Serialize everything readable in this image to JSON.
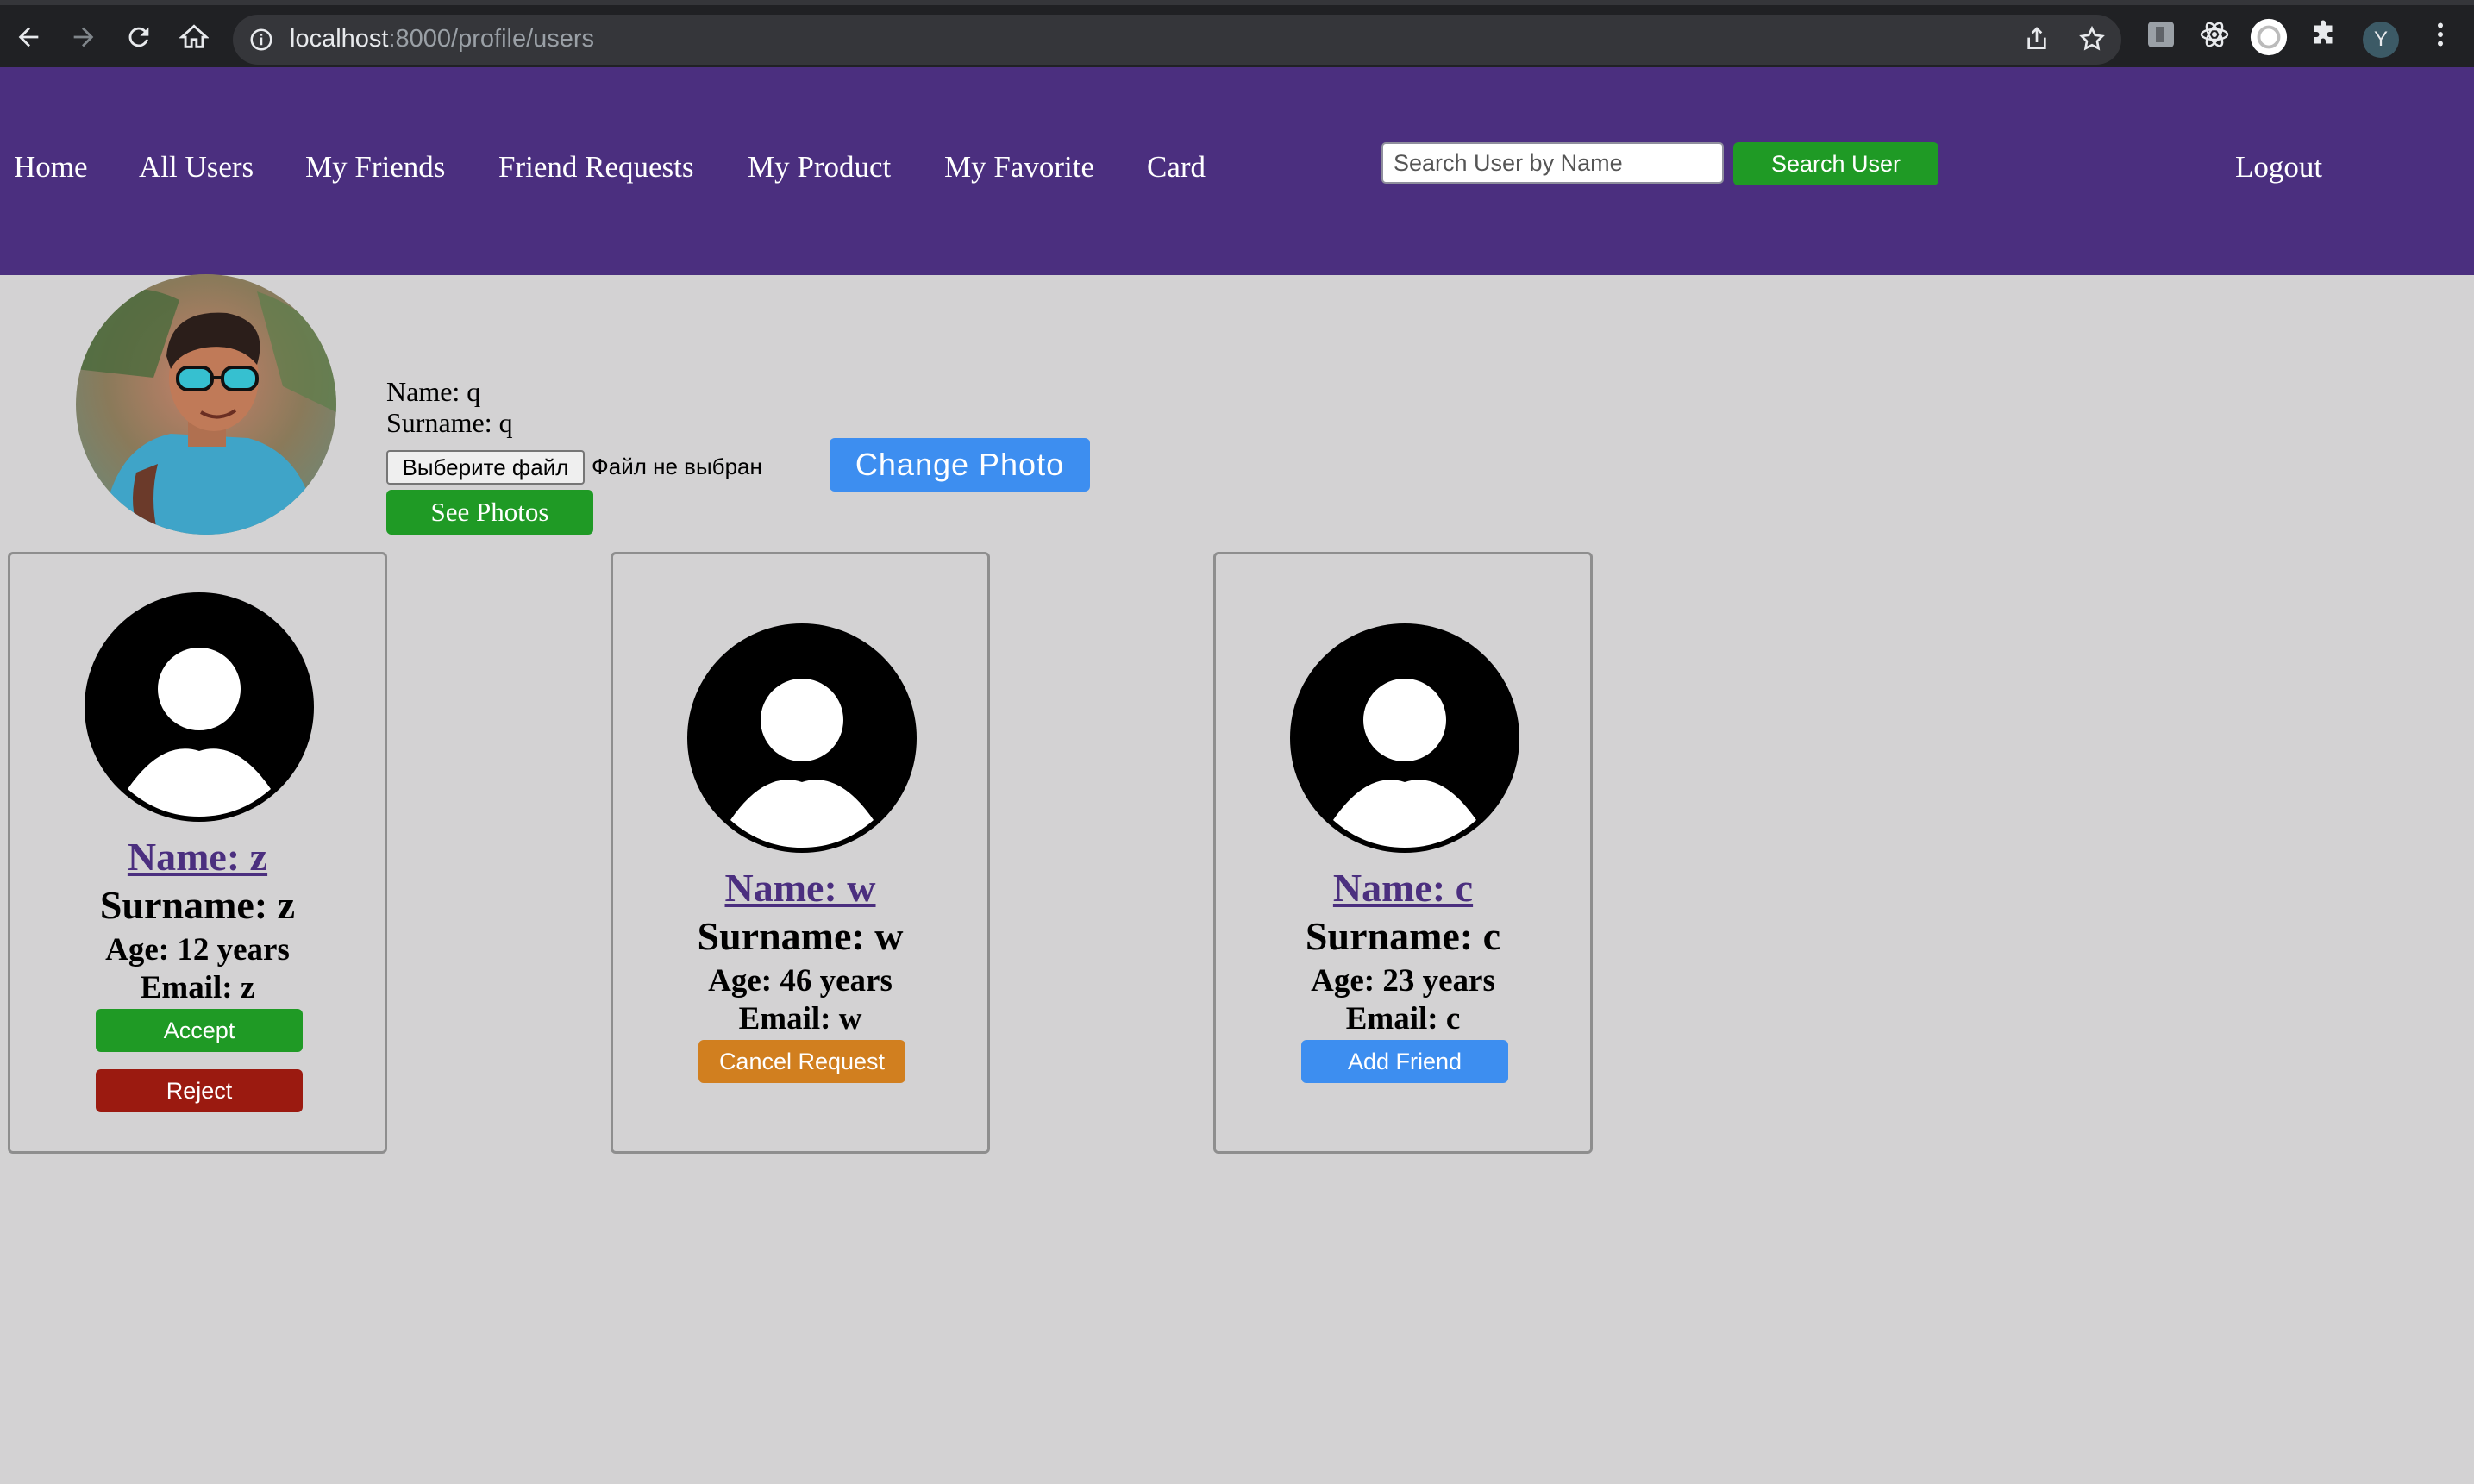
{
  "browser": {
    "url_host": "localhost",
    "url_rest": ":8000/profile/users",
    "profile_initial": "Y"
  },
  "nav": {
    "links": [
      "Home",
      "All Users",
      "My Friends",
      "Friend Requests",
      "My Product",
      "My Favorite",
      "Card"
    ],
    "search_placeholder": "Search User by Name",
    "search_button": "Search User",
    "logout": "Logout"
  },
  "profile": {
    "name": "Name: q",
    "surname": "Surname: q",
    "file_button": "Выберите файл",
    "file_status": "Файл не выбран",
    "see_photos": "See Photos",
    "change_photo": "Change Photo"
  },
  "users": [
    {
      "name": "Name: z",
      "surname": "Surname: z",
      "age": "Age: 12 years",
      "email": "Email: z",
      "actions": [
        {
          "label": "Accept",
          "color": "#1f9a25"
        },
        {
          "label": "Reject",
          "color": "#9b1a10"
        }
      ]
    },
    {
      "name": "Name: w",
      "surname": "Surname: w",
      "age": "Age: 46 years",
      "email": "Email: w",
      "actions": [
        {
          "label": "Cancel Request",
          "color": "#d17f1f"
        }
      ]
    },
    {
      "name": "Name: c",
      "surname": "Surname: c",
      "age": "Age: 23 years",
      "email": "Email: c",
      "actions": [
        {
          "label": "Add Friend",
          "color": "#3d8ef0"
        }
      ]
    }
  ],
  "colors": {
    "nav_bg": "#4b2f7f",
    "page_bg": "#d3d2d3",
    "link": "#4b2f7f"
  },
  "icons": [
    "back-icon",
    "forward-icon",
    "reload-icon",
    "home-icon",
    "info-icon",
    "share-icon",
    "star-icon",
    "extension-icon",
    "react-devtools-icon",
    "puzzle-icon",
    "menu-icon",
    "user-avatar-icon"
  ]
}
